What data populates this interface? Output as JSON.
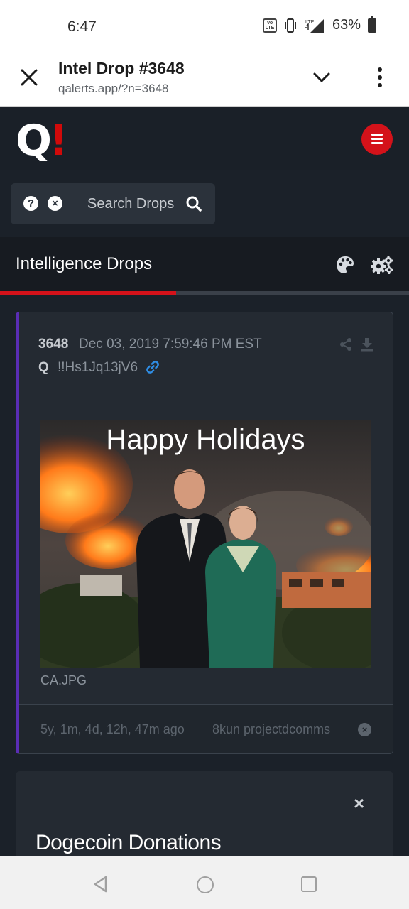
{
  "status_bar": {
    "time": "6:47",
    "volte_label": "Vo LTE",
    "network_label": "LTE",
    "battery": "63%"
  },
  "browser": {
    "title": "Intel Drop #3648",
    "url": "qalerts.app/?n=3648"
  },
  "site": {
    "logo_main": "Q",
    "logo_accent": "!",
    "accent_color": "#d4121a",
    "search": {
      "help_glyph": "?",
      "clear_glyph": "×",
      "placeholder": "Search Drops"
    },
    "section_title": "Intelligence Drops",
    "scroll_progress": 0.43
  },
  "drop": {
    "number": "3648",
    "date": "Dec 03, 2019 7:59:46 PM EST",
    "author": "Q",
    "tripcode": "!!Hs1Jq13jV6",
    "image_caption": "Happy Holidays",
    "filename": "CA.JPG",
    "age": "5y, 1m, 4d, 12h, 47m ago",
    "source": "8kun projectdcomms",
    "dismiss_glyph": "×",
    "border_color": "#5a2db5"
  },
  "donations": {
    "close_glyph": "×",
    "title": "Dogecoin Donations"
  },
  "icons": [
    "close-icon",
    "chevron-down-icon",
    "more-vert-icon",
    "menu-icon",
    "help-icon",
    "clear-icon",
    "search-icon",
    "palette-icon",
    "gears-icon",
    "link-icon",
    "share-icon",
    "download-icon",
    "back-icon",
    "home-icon",
    "recent-apps-icon"
  ]
}
